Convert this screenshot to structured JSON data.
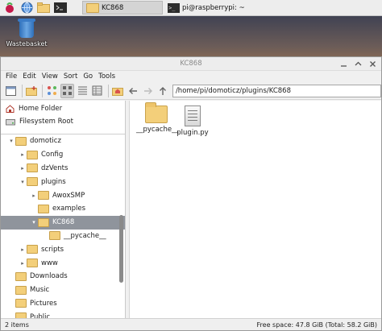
{
  "taskbar": {
    "apps": [
      "raspberry-menu-icon",
      "web-browser-icon",
      "file-manager-icon",
      "terminal-icon"
    ],
    "tasks": [
      {
        "label": "KC868",
        "icon": "folder-icon"
      },
      {
        "label": "pi@raspberrypi: ~",
        "icon": "terminal-icon"
      }
    ]
  },
  "desktop": {
    "trash_label": "Wastebasket"
  },
  "window": {
    "title": "KC868",
    "menu": [
      "File",
      "Edit",
      "View",
      "Sort",
      "Go",
      "Tools"
    ],
    "address": "/home/pi/domoticz/plugins/KC868",
    "places": [
      {
        "label": "Home Folder",
        "icon": "home-icon"
      },
      {
        "label": "Filesystem Root",
        "icon": "drive-icon"
      }
    ],
    "tree": [
      {
        "label": "domoticz",
        "arrow": "▾",
        "indent": 1
      },
      {
        "label": "Config",
        "arrow": "▸",
        "indent": 2
      },
      {
        "label": "dzVents",
        "arrow": "▸",
        "indent": 2
      },
      {
        "label": "plugins",
        "arrow": "▾",
        "indent": 2
      },
      {
        "label": "AwoxSMP",
        "arrow": "▸",
        "indent": 3
      },
      {
        "label": "examples",
        "arrow": "",
        "indent": 3
      },
      {
        "label": "KC868",
        "arrow": "▾",
        "indent": 3,
        "selected": true
      },
      {
        "label": "__pycache__",
        "arrow": "",
        "indent": 4
      },
      {
        "label": "scripts",
        "arrow": "▸",
        "indent": 2
      },
      {
        "label": "www",
        "arrow": "▸",
        "indent": 2
      },
      {
        "label": "Downloads",
        "arrow": "",
        "indent": 1
      },
      {
        "label": "Music",
        "arrow": "",
        "indent": 1
      },
      {
        "label": "Pictures",
        "arrow": "",
        "indent": 1
      },
      {
        "label": "Public",
        "arrow": "",
        "indent": 1
      }
    ],
    "files": [
      {
        "label": "__pycache__",
        "type": "folder"
      },
      {
        "label": "plugin.py",
        "type": "file"
      }
    ],
    "status": {
      "left": "2 items",
      "right": "Free space: 47.8 GiB (Total: 58.2 GiB)"
    }
  },
  "colors": {
    "selection": "#8f949c",
    "folder": "#f3cf7a"
  }
}
